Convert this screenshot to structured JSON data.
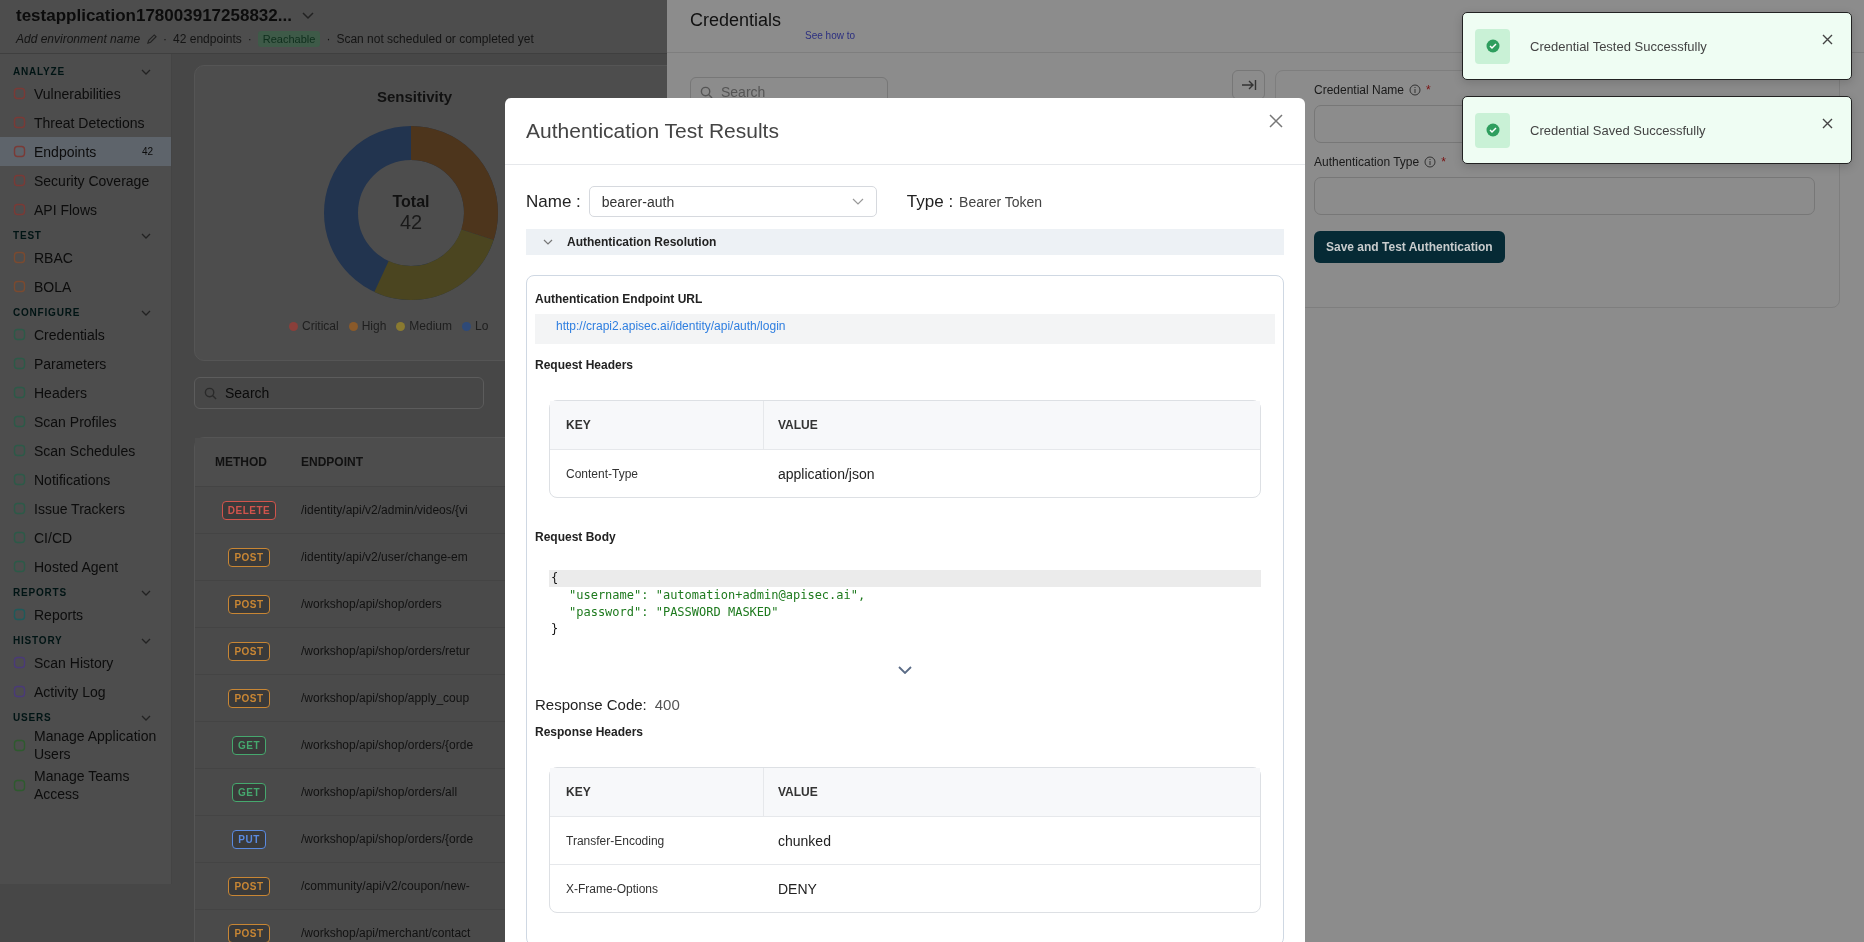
{
  "header": {
    "title": "testapplication178003917258832...",
    "environment_placeholder": "Add environment name",
    "separator": "·",
    "endpoints": "42 endpoints",
    "status_badge": "Reachable",
    "scan_status": "Scan not scheduled or completed yet"
  },
  "sidebar": {
    "sections": [
      {
        "title": "ANALYZE",
        "items": [
          {
            "label": "Vulnerabilities",
            "selected": false
          },
          {
            "label": "Threat Detections",
            "selected": false
          },
          {
            "label": "Endpoints",
            "selected": true,
            "count": "42"
          },
          {
            "label": "Security Coverage",
            "selected": false
          },
          {
            "label": "API Flows",
            "selected": false
          }
        ]
      },
      {
        "title": "TEST",
        "items": [
          {
            "label": "RBAC",
            "selected": false
          },
          {
            "label": "BOLA",
            "selected": false
          }
        ]
      },
      {
        "title": "CONFIGURE",
        "items": [
          {
            "label": "Credentials",
            "selected": false
          },
          {
            "label": "Parameters",
            "selected": false
          },
          {
            "label": "Headers",
            "selected": false
          },
          {
            "label": "Scan Profiles",
            "selected": false
          },
          {
            "label": "Scan Schedules",
            "selected": false
          },
          {
            "label": "Notifications",
            "selected": false
          },
          {
            "label": "Issue Trackers",
            "selected": false
          },
          {
            "label": "CI/CD",
            "selected": false
          },
          {
            "label": "Hosted Agent",
            "selected": false
          }
        ]
      },
      {
        "title": "REPORTS",
        "items": [
          {
            "label": "Reports",
            "selected": false
          }
        ]
      },
      {
        "title": "HISTORY",
        "items": [
          {
            "label": "Scan History",
            "selected": false
          },
          {
            "label": "Activity Log",
            "selected": false
          }
        ]
      },
      {
        "title": "USERS",
        "items": [
          {
            "label": "Manage Application Users",
            "selected": false
          },
          {
            "label": "Manage Teams Access",
            "selected": false
          }
        ]
      }
    ]
  },
  "sensitivity": {
    "title": "Sensitivity",
    "total_label": "Total",
    "total": "42",
    "legend": [
      {
        "label": "Critical",
        "color": "#8a3f3a"
      },
      {
        "label": "High",
        "color": "#8a5a2a"
      },
      {
        "label": "Medium",
        "color": "#8a7a30"
      },
      {
        "label": "Lo",
        "color": "#2f4a78"
      }
    ]
  },
  "endpoint_search": {
    "placeholder": "Search"
  },
  "endpoints_table": {
    "columns": [
      "METHOD",
      "ENDPOINT"
    ],
    "rows": [
      {
        "method": "DELETE",
        "color": "#d0544c",
        "endpoint": "/identity/api/v2/admin/videos/{vi"
      },
      {
        "method": "POST",
        "color": "#c88634",
        "endpoint": "/identity/api/v2/user/change-em"
      },
      {
        "method": "POST",
        "color": "#c88634",
        "endpoint": "/workshop/api/shop/orders"
      },
      {
        "method": "POST",
        "color": "#c88634",
        "endpoint": "/workshop/api/shop/orders/retur"
      },
      {
        "method": "POST",
        "color": "#c88634",
        "endpoint": "/workshop/api/shop/apply_coup"
      },
      {
        "method": "GET",
        "color": "#46a86e",
        "endpoint": "/workshop/api/shop/orders/{orde"
      },
      {
        "method": "GET",
        "color": "#46a86e",
        "endpoint": "/workshop/api/shop/orders/all"
      },
      {
        "method": "PUT",
        "color": "#5a8ae0",
        "endpoint": "/workshop/api/shop/orders/{orde"
      },
      {
        "method": "POST",
        "color": "#c88634",
        "endpoint": "/community/api/v2/coupon/new-"
      },
      {
        "method": "POST",
        "color": "#c88634",
        "endpoint": "/workshop/api/merchant/contact"
      }
    ]
  },
  "drawer": {
    "title": "Credentials",
    "help_link": "See how to",
    "search_placeholder": "Search",
    "fields": [
      {
        "label": "Credential Name",
        "required_mark": "*"
      },
      {
        "label": "Authentication Type",
        "required_mark": "*"
      }
    ],
    "submit_button": "Save and Test Authentication"
  },
  "modal": {
    "title": "Authentication Test Results",
    "name_label": "Name :",
    "name_value": "bearer-auth",
    "type_label": "Type :",
    "type_value": "Bearer Token",
    "section": {
      "title": "Authentication Resolution",
      "expanded": true
    },
    "url_label": "Authentication Endpoint URL",
    "url": "http://crapi2.apisec.ai/identity/api/auth/login",
    "request_headers_label": "Request Headers",
    "request_headers": {
      "columns": [
        "KEY",
        "VALUE"
      ],
      "rows": [
        [
          "Content-Type",
          "application/json"
        ]
      ]
    },
    "request_body_label": "Request Body",
    "request_body": [
      {
        "kind": "brace",
        "text": "{"
      },
      {
        "kind": "pair",
        "key": "\"username\":",
        "value": "\"automation+admin@apisec.ai\","
      },
      {
        "kind": "pair",
        "key": "\"password\":",
        "value": "\"PASSWORD MASKED\""
      },
      {
        "kind": "brace",
        "text": "}"
      }
    ],
    "response_code_label": "Response Code:",
    "response_code": "400",
    "response_headers_label": "Response Headers",
    "response_headers": {
      "columns": [
        "KEY",
        "VALUE"
      ],
      "rows": [
        [
          "Transfer-Encoding",
          "chunked"
        ],
        [
          "X-Frame-Options",
          "DENY"
        ]
      ]
    }
  },
  "toasts": [
    {
      "message": "Credential Tested Successfully"
    },
    {
      "message": "Credential Saved Successfully"
    }
  ]
}
